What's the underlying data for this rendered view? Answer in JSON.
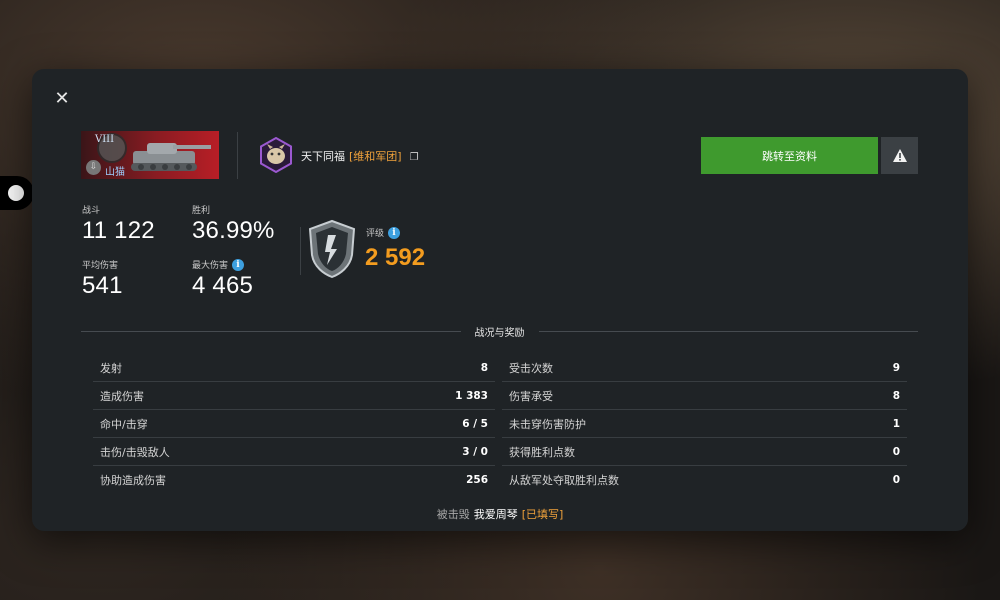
{
  "modal": {
    "close_icon": "close-icon"
  },
  "tank": {
    "tier": "VIII",
    "name": "山猫",
    "nation_icon": "germany-emblem-icon"
  },
  "player": {
    "name": "天下同福",
    "clan": "[维和军团]",
    "emblem_icon": "clan-emblem-icon",
    "copy_icon": "copy-icon"
  },
  "actions": {
    "profile_label": "跳转至资料",
    "report_icon": "warning-icon",
    "profile_color": "#3f9a2e"
  },
  "stats": {
    "battles_label": "战斗",
    "battles_value": "11 122",
    "winrate_label": "胜利",
    "winrate_value": "36.99%",
    "avg_damage_label": "平均伤害",
    "avg_damage_value": "541",
    "max_damage_label": "最大伤害",
    "max_damage_value": "4 465",
    "rating_label": "评级",
    "rating_value": "2 592",
    "rating_color": "#f39c1f"
  },
  "section": {
    "title": "战况与奖励"
  },
  "table": {
    "left": [
      {
        "name": "发射",
        "value": "8"
      },
      {
        "name": "造成伤害",
        "value": "1 383"
      },
      {
        "name": "命中/击穿",
        "value": "6 / 5"
      },
      {
        "name": "击伤/击毁敌人",
        "value": "3 / 0"
      },
      {
        "name": "协助造成伤害",
        "value": "256"
      }
    ],
    "right": [
      {
        "name": "受击次数",
        "value": "9"
      },
      {
        "name": "伤害承受",
        "value": "8"
      },
      {
        "name": "未击穿伤害防护",
        "value": "1"
      },
      {
        "name": "获得胜利点数",
        "value": "0"
      },
      {
        "name": "从敌军处夺取胜利点数",
        "value": "0"
      }
    ]
  },
  "footer": {
    "killed_by_label": "被击毁",
    "killer_name": "我爱周琴",
    "killer_tag": "[已填写]"
  }
}
